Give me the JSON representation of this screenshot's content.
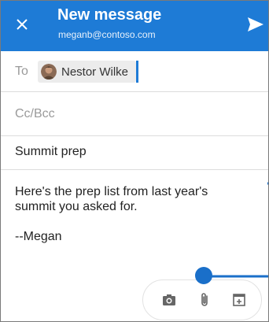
{
  "header": {
    "title": "New message",
    "account": "meganb@contoso.com"
  },
  "recipients": {
    "to_label": "To",
    "to": [
      {
        "name": "Nestor Wilke"
      }
    ],
    "cc_placeholder": "Cc/Bcc"
  },
  "subject": "Summit prep",
  "body": {
    "line1": "Here's the prep list from last year's",
    "line2": "summit you asked for.",
    "signature": "--Megan"
  },
  "toolbar": {
    "items": [
      "camera-icon",
      "attachment-icon",
      "add-icon"
    ]
  },
  "colors": {
    "accent": "#1e7bd6",
    "callout": "#1a6fc9"
  }
}
